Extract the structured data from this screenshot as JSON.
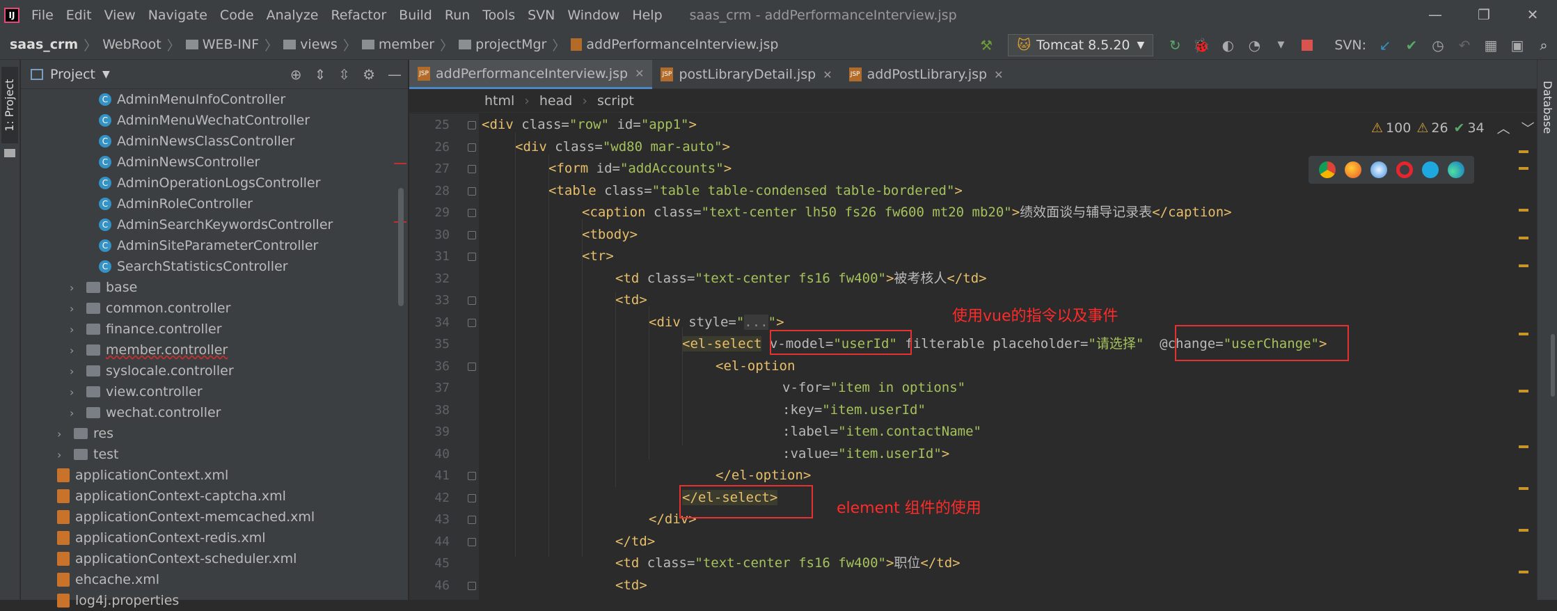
{
  "window": {
    "title": "saas_crm - addPerformanceInterview.jsp",
    "controls": [
      "—",
      "❐",
      "✕"
    ]
  },
  "menu": [
    "File",
    "Edit",
    "View",
    "Navigate",
    "Code",
    "Analyze",
    "Refactor",
    "Build",
    "Run",
    "Tools",
    "SVN",
    "Window",
    "Help"
  ],
  "breadcrumb": [
    "saas_crm",
    "WebRoot",
    "WEB-INF",
    "views",
    "member",
    "projectMgr",
    "addPerformanceInterview.jsp"
  ],
  "toolbar": {
    "run_config": "Tomcat 8.5.20",
    "svn_label": "SVN:"
  },
  "left_strip": {
    "project_tab": "1: Project"
  },
  "right_strip": {
    "database_tab": "Database"
  },
  "project_panel": {
    "title": "Project",
    "items": [
      {
        "label": "AdminMenuInfoController",
        "type": "class",
        "indent": 2
      },
      {
        "label": "AdminMenuWechatController",
        "type": "class",
        "indent": 2
      },
      {
        "label": "AdminNewsClassController",
        "type": "class",
        "indent": 2
      },
      {
        "label": "AdminNewsController",
        "type": "class",
        "indent": 2
      },
      {
        "label": "AdminOperationLogsController",
        "type": "class",
        "indent": 2
      },
      {
        "label": "AdminRoleController",
        "type": "class",
        "indent": 2
      },
      {
        "label": "AdminSearchKeywordsController",
        "type": "class",
        "indent": 2
      },
      {
        "label": "AdminSiteParameterController",
        "type": "class",
        "indent": 2
      },
      {
        "label": "SearchStatisticsController",
        "type": "class",
        "indent": 2
      },
      {
        "label": "base",
        "type": "package",
        "indent": 1
      },
      {
        "label": "common.controller",
        "type": "package",
        "indent": 1
      },
      {
        "label": "finance.controller",
        "type": "package",
        "indent": 1
      },
      {
        "label": "member.controller",
        "type": "package",
        "indent": 1
      },
      {
        "label": "syslocale.controller",
        "type": "package",
        "indent": 1
      },
      {
        "label": "view.controller",
        "type": "package",
        "indent": 1
      },
      {
        "label": "wechat.controller",
        "type": "package",
        "indent": 1
      },
      {
        "label": "res",
        "type": "folder",
        "indent": 0
      },
      {
        "label": "test",
        "type": "folder",
        "indent": 0
      },
      {
        "label": "applicationContext.xml",
        "type": "xml",
        "indent": 0
      },
      {
        "label": "applicationContext-captcha.xml",
        "type": "xml",
        "indent": 0
      },
      {
        "label": "applicationContext-memcached.xml",
        "type": "xml",
        "indent": 0
      },
      {
        "label": "applicationContext-redis.xml",
        "type": "xml",
        "indent": 0
      },
      {
        "label": "applicationContext-scheduler.xml",
        "type": "xml",
        "indent": 0
      },
      {
        "label": "ehcache.xml",
        "type": "xml",
        "indent": 0
      },
      {
        "label": "log4j.properties",
        "type": "xml",
        "indent": 0
      }
    ]
  },
  "tabs": [
    {
      "label": "addPerformanceInterview.jsp",
      "active": true
    },
    {
      "label": "postLibraryDetail.jsp",
      "active": false
    },
    {
      "label": "addPostLibrary.jsp",
      "active": false
    }
  ],
  "editor_breadcrumb": [
    "html",
    "head",
    "script"
  ],
  "inspections": {
    "warnings": "100",
    "weak": "26",
    "ok": "34"
  },
  "code_lines": [
    {
      "n": "25",
      "indent": 0,
      "html": "<span class='tg'>&lt;div </span><span class='at'>class=</span><span class='av'>\"row\"</span><span class='at'> id=</span><span class='av'>\"app1\"</span><span class='tg'>&gt;</span>"
    },
    {
      "n": "26",
      "indent": 1,
      "html": "<span class='tg'>&lt;div </span><span class='at'>class=</span><span class='av'>\"wd80 mar-auto\"</span><span class='tg'>&gt;</span>"
    },
    {
      "n": "27",
      "indent": 2,
      "html": "<span class='tg'>&lt;form </span><span class='at'>id=</span><span class='av'>\"addAccounts\"</span><span class='tg'>&gt;</span>"
    },
    {
      "n": "28",
      "indent": 2,
      "html": "<span class='tg'>&lt;table </span><span class='at'>class=</span><span class='av'>\"table table-condensed table-bordered\"</span><span class='tg'>&gt;</span>"
    },
    {
      "n": "29",
      "indent": 3,
      "html": "<span class='tg'>&lt;caption </span><span class='at'>class=</span><span class='av'>\"text-center lh50 fs26 fw600 mt20 mb20\"</span><span class='tg'>&gt;</span><span class='cn'>绩效面谈与辅导记录表</span><span class='tg'>&lt;/caption&gt;</span>"
    },
    {
      "n": "30",
      "indent": 3,
      "html": "<span class='tg'>&lt;tbody&gt;</span>"
    },
    {
      "n": "31",
      "indent": 3,
      "html": "<span class='tg'>&lt;tr&gt;</span>"
    },
    {
      "n": "32",
      "indent": 4,
      "html": "<span class='tg'>&lt;td </span><span class='at'>class=</span><span class='av'>\"text-center fs16 fw400\"</span><span class='tg'>&gt;</span><span class='cn'>被考核人</span><span class='tg'>&lt;/td&gt;</span>"
    },
    {
      "n": "33",
      "indent": 4,
      "html": "<span class='tg'>&lt;td&gt;</span>"
    },
    {
      "n": "34",
      "indent": 5,
      "html": "<span class='tg'>&lt;div </span><span class='at'>style=</span><span class='av'>\"<span style='background:#3a3a3a;color:#888'>...</span>\"</span><span class='tg'>&gt;</span>"
    },
    {
      "n": "35",
      "indent": 6,
      "html": "<span class='tg hl'>&lt;el-select</span><span class='at'> v-model=</span><span class='av'>\"userId\"</span><span class='at'> filterable placeholder=</span><span class='av'>\"请选择\"</span><span class='at'>  @change=</span><span class='av'>\"userChange\"</span><span class='tg'>&gt;</span>"
    },
    {
      "n": "36",
      "indent": 7,
      "html": "<span class='tg'>&lt;el-option</span>"
    },
    {
      "n": "37",
      "indent": 9,
      "html": "<span class='at'>v-for=</span><span class='av'>\"item in options\"</span>"
    },
    {
      "n": "38",
      "indent": 9,
      "html": "<span class='at'>:key=</span><span class='av'>\"item.userId\"</span>"
    },
    {
      "n": "39",
      "indent": 9,
      "html": "<span class='at'>:label=</span><span class='av'>\"item.contactName\"</span>"
    },
    {
      "n": "40",
      "indent": 9,
      "html": "<span class='at'>:value=</span><span class='av'>\"item.userId\"</span><span class='tg'>&gt;</span>"
    },
    {
      "n": "41",
      "indent": 7,
      "html": "<span class='tg'>&lt;/el-option&gt;</span>"
    },
    {
      "n": "42",
      "indent": 6,
      "html": "<span class='tg hl'>&lt;/el-select&gt;</span>"
    },
    {
      "n": "43",
      "indent": 5,
      "html": "<span class='tg'>&lt;/div&gt;</span>"
    },
    {
      "n": "44",
      "indent": 4,
      "html": "<span class='tg'>&lt;/td&gt;</span>"
    },
    {
      "n": "45",
      "indent": 4,
      "html": "<span class='tg'>&lt;td </span><span class='at'>class=</span><span class='av'>\"text-center fs16 fw400\"</span><span class='tg'>&gt;</span><span class='cn'>职位</span><span class='tg'>&lt;/td&gt;</span>"
    },
    {
      "n": "46",
      "indent": 4,
      "html": "<span class='tg'>&lt;td&gt;</span>"
    }
  ],
  "annotations": {
    "vue_directive": "使用vue的指令以及事件",
    "element_component": "element 组件的使用"
  }
}
